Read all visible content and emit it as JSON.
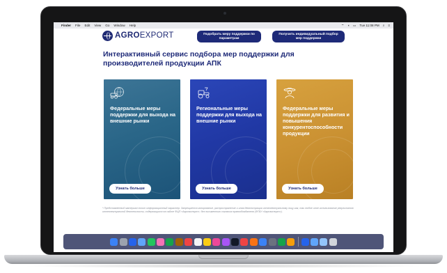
{
  "menubar": {
    "apple": "",
    "app": "Finder",
    "items": [
      "File",
      "Edit",
      "View",
      "Go",
      "Window",
      "Help"
    ],
    "clock": "Tue 11:08 PM"
  },
  "header": {
    "logo_bold": "AGRO",
    "logo_light": "EXPORT",
    "btn1": "Подобрать меру поддержки по параметрам",
    "btn2": "Получить индивидуальный подбор мер поддержки"
  },
  "title": "Интерактивный сервис подбора мер поддержки для производителей продукции АПК",
  "cards": [
    {
      "text": "Федеральные меры поддержки для выхода на внешние рынки",
      "button": "Узнать больше",
      "icon": "globe-tractor-icon",
      "color": "#2a6688"
    },
    {
      "text": "Региональные меры поддержки для выхода на внешние рынки",
      "button": "Узнать больше",
      "icon": "tractor-icon",
      "color": "#2139a6"
    },
    {
      "text": "Федеральные меры поддержки для развития и повышения конкурентоспособности продукции",
      "button": "Узнать больше",
      "icon": "farmer-icon",
      "color": "#cb9233"
    }
  ],
  "disclaimer": "* Представленный материал носит информационный характер. Запрещается копирование, распространение и иная демонстрация интеллектуальному лицу как, так любое иное использование результатов интеллектуальной деятельности, содержащихся на сайте ФЦП «Агроэкспорт», без письменного согласия правообладателя (ФГБУ «Агроэкспорт»).",
  "dock": {
    "apps": [
      "finder-icon",
      "launchpad-icon",
      "safari-icon",
      "mail-icon",
      "maps-icon",
      "photos-icon",
      "facetime-icon",
      "contacts-icon",
      "calendar-icon",
      "reminders-icon",
      "notes-icon",
      "music-icon",
      "podcasts-icon",
      "tv-icon",
      "news-icon",
      "books-icon",
      "app-store-icon",
      "system-preferences-icon",
      "numbers-icon",
      "pages-icon",
      "keynote-icon",
      "downloads-folder-icon",
      "documents-folder-icon",
      "trash-icon"
    ],
    "colors": [
      "#3b82f6",
      "#9ca3af",
      "#2563eb",
      "#60a5fa",
      "#22c55e",
      "#f472b6",
      "#16a34a",
      "#a16207",
      "#ef4444",
      "#f3f4f6",
      "#facc15",
      "#ec4899",
      "#a855f7",
      "#111827",
      "#ef4444",
      "#f97316",
      "#3b82f6",
      "#6b7280",
      "#16a34a",
      "#f59e0b",
      "#2563eb",
      "#60a5fa",
      "#93c5fd",
      "#d1d5db"
    ]
  }
}
